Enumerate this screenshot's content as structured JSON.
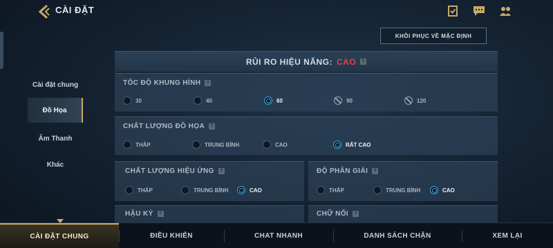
{
  "header": {
    "title": "CÀI ĐẶT",
    "icons": [
      "back-chevron-icon",
      "checklist-icon",
      "chat-icon",
      "friends-icon"
    ]
  },
  "reset_button": "KHÔI PHỤC VỀ MẶC ĐỊNH",
  "sidebar": {
    "items": [
      {
        "label": "Cài đặt chung"
      },
      {
        "label": "Đồ Họa",
        "active": true
      },
      {
        "label": "Âm Thanh"
      },
      {
        "label": "Khác"
      }
    ]
  },
  "risk": {
    "label": "RỦI RO HIỆU NĂNG:",
    "value": "CAO",
    "value_color": "#e0424c"
  },
  "sections": {
    "frame_rate": {
      "title": "TỐC ĐỘ KHUNG HÌNH",
      "options": [
        {
          "label": "30",
          "state": "off"
        },
        {
          "label": "40",
          "state": "off"
        },
        {
          "label": "60",
          "state": "selected"
        },
        {
          "label": "90",
          "state": "disabled"
        },
        {
          "label": "120",
          "state": "disabled"
        }
      ]
    },
    "graphics_quality": {
      "title": "CHẤT LƯỢNG ĐỒ HỌA",
      "options": [
        {
          "label": "THẤP",
          "state": "off"
        },
        {
          "label": "TRUNG BÌNH",
          "state": "off"
        },
        {
          "label": "CAO",
          "state": "off"
        },
        {
          "label": "RẤT CAO",
          "state": "selected"
        }
      ]
    },
    "effects_quality": {
      "title": "CHẤT LƯỢNG HIỆU ỨNG",
      "options": [
        {
          "label": "THẤP",
          "state": "off"
        },
        {
          "label": "TRUNG BÌNH",
          "state": "off"
        },
        {
          "label": "CAO",
          "state": "selected"
        }
      ]
    },
    "resolution": {
      "title": "ĐỘ PHÂN GIẢI",
      "options": [
        {
          "label": "THẤP",
          "state": "off"
        },
        {
          "label": "TRUNG BÌNH",
          "state": "off"
        },
        {
          "label": "CAO",
          "state": "selected"
        }
      ]
    },
    "post_processing": {
      "title": "HẬU KỲ"
    },
    "floating_text": {
      "title": "CHỮ NỔI"
    }
  },
  "help_glyph": "?",
  "bottom_nav": {
    "tabs": [
      {
        "label": "CÀI ĐẶT CHUNG",
        "active": true
      },
      {
        "label": "ĐIỀU KHIỂN"
      },
      {
        "label": "CHAT NHANH"
      },
      {
        "label": "DANH SÁCH CHẶN"
      },
      {
        "label": "XEM LẠI"
      }
    ]
  },
  "colors": {
    "accent_blue": "#39a9e0",
    "gold": "#cfae6a",
    "risk_red": "#e0424c"
  }
}
